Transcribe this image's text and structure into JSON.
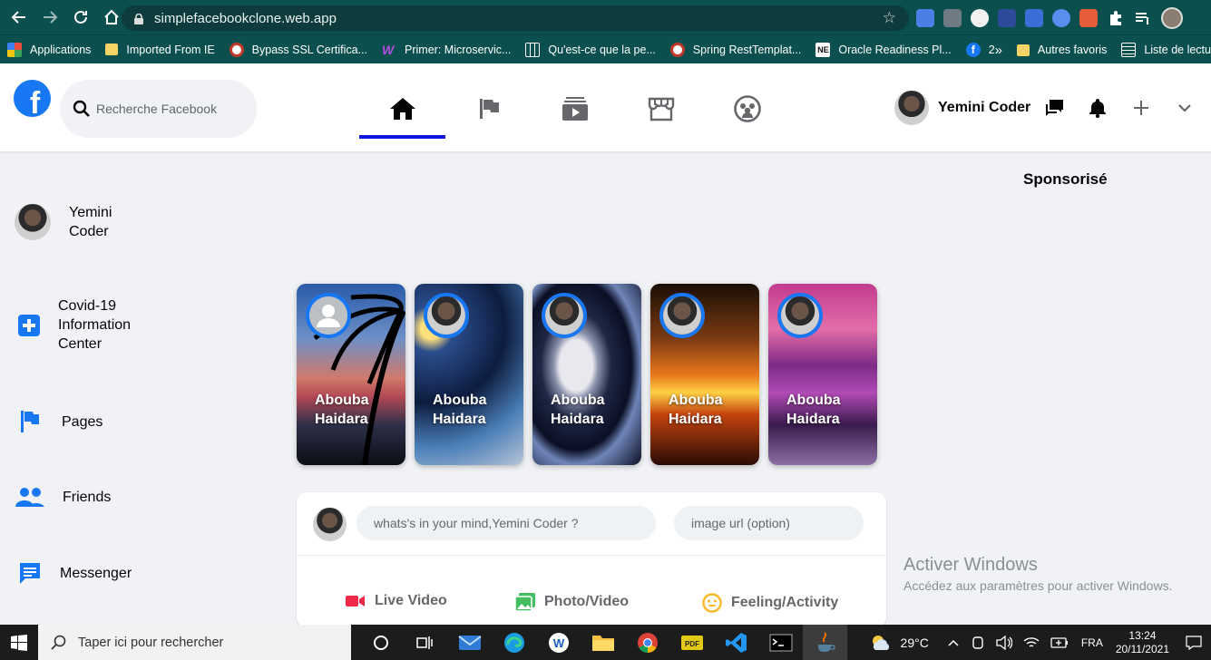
{
  "browser": {
    "url": "simplefacebookclone.web.app",
    "bookmarks": [
      {
        "label": "Applications",
        "icon": "apps-grid-icon",
        "color": "#e84c3d"
      },
      {
        "label": "Imported From IE",
        "icon": "folder-icon",
        "color": "#f6d365"
      },
      {
        "label": "Bypass SSL Certifica...",
        "icon": "site-icon",
        "color": "#ffffff"
      },
      {
        "label": "Primer: Microservic...",
        "icon": "w-logo-icon",
        "color": "#b44be1"
      },
      {
        "label": "Qu'est-ce que la pe...",
        "icon": "grid-page-icon",
        "color": "#ffffff"
      },
      {
        "label": "Spring RestTemplat...",
        "icon": "site-icon",
        "color": "#ffffff"
      },
      {
        "label": "Oracle Readiness Pl...",
        "icon": "ne-logo-icon",
        "color": "#ffffff"
      },
      {
        "label": "2",
        "icon": "facebook-icon",
        "color": "#1877f2"
      }
    ],
    "bookmarks_more": "»",
    "bookmarks_right": [
      {
        "label": "Autres favoris",
        "icon": "folder-icon"
      },
      {
        "label": "Liste de lectu",
        "icon": "reading-list-icon"
      }
    ]
  },
  "header": {
    "search_placeholder": "Recherche Facebook",
    "user_name": "Yemini Coder",
    "tabs": [
      "home",
      "pages",
      "watch",
      "marketplace",
      "groups"
    ],
    "active_tab": "home",
    "accent": "#1017e0"
  },
  "sidebar": {
    "profile_name": "Yemini Coder",
    "items": [
      {
        "label": "Covid-19 Information Center",
        "icon": "medical-cross-icon"
      },
      {
        "label": "Pages",
        "icon": "flag-icon"
      },
      {
        "label": "Friends",
        "icon": "people-icon"
      },
      {
        "label": "Messenger",
        "icon": "chat-icon"
      }
    ]
  },
  "stories": [
    {
      "name": "Abouba Haidara",
      "has_photo": false
    },
    {
      "name": "Abouba Haidara",
      "has_photo": true
    },
    {
      "name": "Abouba Haidara",
      "has_photo": true
    },
    {
      "name": "Abouba Haidara",
      "has_photo": true
    },
    {
      "name": "Abouba Haidara",
      "has_photo": true
    }
  ],
  "composer": {
    "post_placeholder": "whats's in your mind,Yemini Coder ?",
    "image_placeholder": "image url (option)",
    "actions": [
      {
        "label": "Live Video",
        "color": "#f02849"
      },
      {
        "label": "Photo/Video",
        "color": "#45bd62"
      },
      {
        "label": "Feeling/Activity",
        "color": "#f7b928"
      }
    ]
  },
  "right": {
    "sponsored": "Sponsorisé"
  },
  "watermark": {
    "title": "Activer Windows",
    "subtitle": "Accédez aux paramètres pour activer Windows."
  },
  "taskbar": {
    "search_text": "Taper ici pour rechercher",
    "temperature": "29°C",
    "language": "FRA",
    "time": "13:24",
    "date": "20/11/2021"
  }
}
